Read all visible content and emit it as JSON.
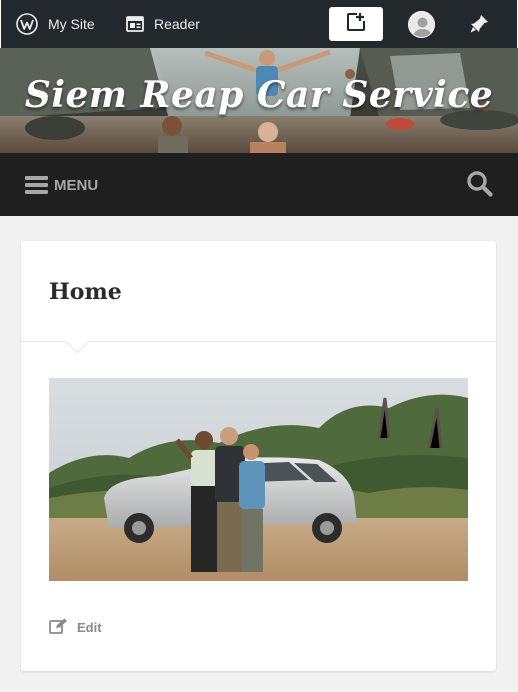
{
  "admin_bar": {
    "my_site_label": "My Site",
    "reader_label": "Reader",
    "icons": {
      "my_site": "wordpress-icon",
      "reader": "reader-icon",
      "write": "write-post-icon",
      "avatar": "user-avatar",
      "notifications": "notifications-bell-icon"
    }
  },
  "header": {
    "site_title": "Siem Reap Car Service"
  },
  "nav": {
    "menu_label": "MENU",
    "search_icon": "search-icon"
  },
  "post": {
    "title": "Home",
    "image_alt": "photo-of-people-with-suv",
    "edit_label": "Edit"
  },
  "colors": {
    "admin_bar_bg": "#23282d",
    "nav_bg": "#1f1f1f",
    "page_bg": "#f1f1f1",
    "card_bg": "#ffffff",
    "muted_text": "#8a8a8a"
  }
}
